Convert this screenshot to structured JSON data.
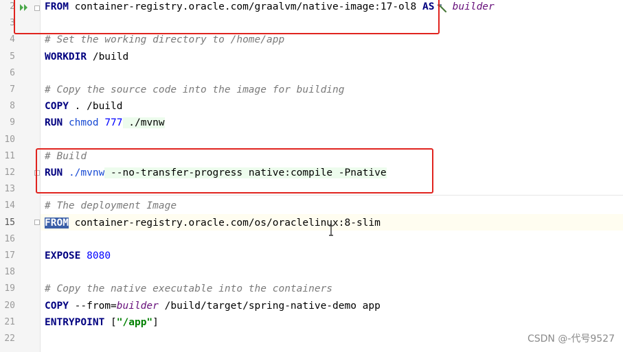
{
  "editor": {
    "lines": [
      {
        "number": "2",
        "segments": [
          {
            "t": "FROM",
            "c": "kw"
          },
          {
            "t": " container-registry.oracle.com/graalvm/native-image:17-ol8 "
          },
          {
            "t": "AS",
            "c": "kw"
          },
          {
            "t": "   "
          },
          {
            "t": "builder",
            "c": "var"
          }
        ]
      },
      {
        "number": "3",
        "segments": []
      },
      {
        "number": "4",
        "segments": [
          {
            "t": "# Set the working directory to /home/app",
            "c": "cm"
          }
        ]
      },
      {
        "number": "5",
        "segments": [
          {
            "t": "WORKDIR",
            "c": "kw"
          },
          {
            "t": " /build"
          }
        ]
      },
      {
        "number": "6",
        "segments": []
      },
      {
        "number": "7",
        "segments": [
          {
            "t": "# Copy the source code into the image for building",
            "c": "cm"
          }
        ]
      },
      {
        "number": "8",
        "segments": [
          {
            "t": "COPY",
            "c": "kw"
          },
          {
            "t": " . /build"
          }
        ]
      },
      {
        "number": "9",
        "segments": [
          {
            "t": "RUN",
            "c": "kw"
          },
          {
            "t": " "
          },
          {
            "t": "chmod",
            "c": "cmd"
          },
          {
            "t": " "
          },
          {
            "t": "777",
            "c": "num"
          },
          {
            "t": " ./mvnw",
            "c": "hilite"
          }
        ]
      },
      {
        "number": "10",
        "segments": []
      },
      {
        "number": "11",
        "segments": [
          {
            "t": "# Build",
            "c": "cm"
          }
        ]
      },
      {
        "number": "12",
        "segments": [
          {
            "t": "RUN",
            "c": "kw"
          },
          {
            "t": " "
          },
          {
            "t": "./mvnw",
            "c": "cmd"
          },
          {
            "t": " --no-transfer-progress native:compile -Pnative",
            "c": "hilite"
          }
        ]
      },
      {
        "number": "13",
        "segments": []
      },
      {
        "number": "14",
        "segments": [
          {
            "t": "# The deployment Image",
            "c": "cm"
          }
        ]
      },
      {
        "number": "15",
        "segments": [
          {
            "t": "FROM",
            "c": "kw sel"
          },
          {
            "t": " container-registry.oracle.com/os/oraclelinux:8-slim"
          }
        ]
      },
      {
        "number": "16",
        "segments": []
      },
      {
        "number": "17",
        "segments": [
          {
            "t": "EXPOSE",
            "c": "kw"
          },
          {
            "t": " "
          },
          {
            "t": "8080",
            "c": "num"
          }
        ]
      },
      {
        "number": "18",
        "segments": []
      },
      {
        "number": "19",
        "segments": [
          {
            "t": "# Copy the native executable into the containers",
            "c": "cm"
          }
        ]
      },
      {
        "number": "20",
        "segments": [
          {
            "t": "COPY",
            "c": "kw"
          },
          {
            "t": " --from="
          },
          {
            "t": "builder",
            "c": "var"
          },
          {
            "t": " /build/target/spring-native-demo app"
          }
        ]
      },
      {
        "number": "21",
        "segments": [
          {
            "t": "ENTRYPOINT",
            "c": "kw"
          },
          {
            "t": " ["
          },
          {
            "t": "\"/app\"",
            "c": "str"
          },
          {
            "t": "]"
          }
        ]
      },
      {
        "number": "22",
        "segments": []
      }
    ]
  },
  "watermark": "CSDN @-代号9527",
  "colors": {
    "annotation_box": "#e0231e",
    "keyword": "#000080",
    "comment": "#7a7a7a"
  }
}
